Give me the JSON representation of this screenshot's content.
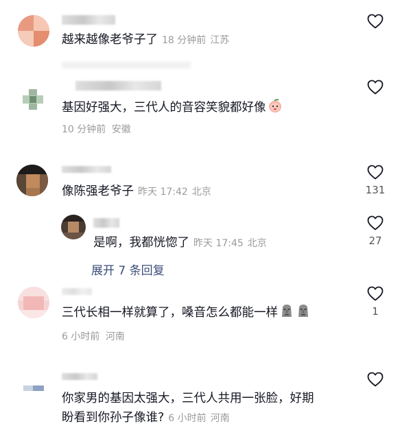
{
  "comments": [
    {
      "text": "越来越像老爷子了",
      "time": "18 分钟前",
      "location": "江苏",
      "likes": ""
    },
    {
      "text": "基因好强大，三代人的音容笑貌都好像",
      "time": "10 分钟前",
      "location": "安徽",
      "likes": ""
    },
    {
      "text": "像陈强老爷子",
      "time": "昨天 17:42",
      "location": "北京",
      "likes": "131",
      "reply": {
        "text": "是啊，我都恍惚了",
        "time": "昨天 17:45",
        "location": "北京",
        "likes": "27"
      },
      "expand_label": "展开 7 条回复"
    },
    {
      "text": "三代长相一样就算了，嗓音怎么都能一样",
      "time": "6 小时前",
      "location": "河南",
      "likes": "1"
    },
    {
      "text_line1": "你家男的基因太强大，三代人共用一张脸，好期",
      "text_line2": "盼看到你孙子像谁?",
      "time": "6 小时前",
      "location": "河南",
      "likes": ""
    }
  ],
  "icons": {
    "like": "heart-outline-icon",
    "emoji_peach": "peach-face-emoji",
    "emoji_stone": "moai-stone-emoji"
  },
  "colors": {
    "text": "#161823",
    "meta": "#9a9a9a",
    "link": "#3c4e7a"
  }
}
